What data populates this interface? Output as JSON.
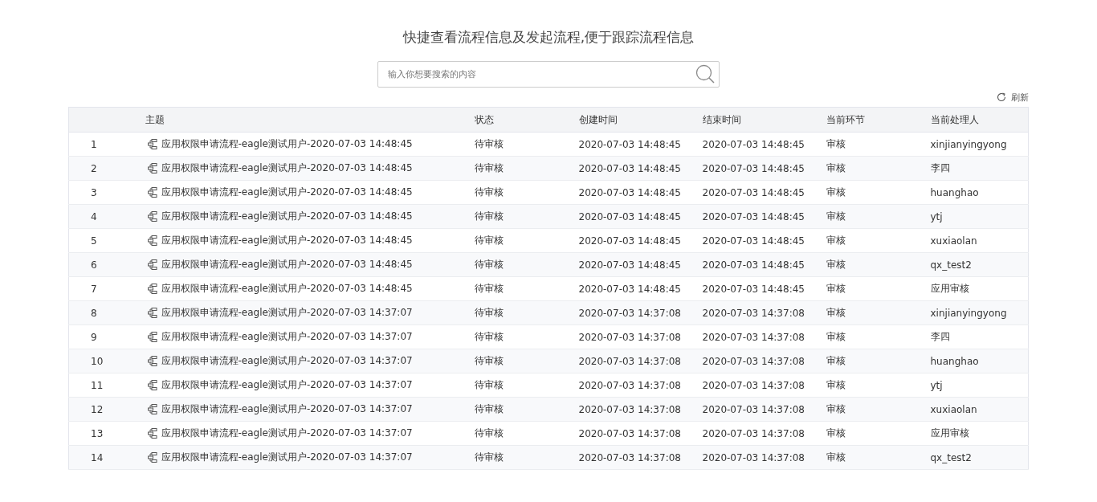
{
  "title": "快捷查看流程信息及发起流程,便于跟踪流程信息",
  "search": {
    "placeholder": "输入你想要搜索的内容"
  },
  "refresh": "刷新",
  "table": {
    "columns": [
      "",
      "主题",
      "状态",
      "创建时间",
      "结束时间",
      "当前环节",
      "当前处理人"
    ],
    "rows": [
      [
        "1",
        "应用权限申请流程-eagle测试用户-2020-07-03 14:48:45",
        "待审核",
        "2020-07-03 14:48:45",
        "2020-07-03 14:48:45",
        "审核",
        "xinjianyingyong"
      ],
      [
        "2",
        "应用权限申请流程-eagle测试用户-2020-07-03 14:48:45",
        "待审核",
        "2020-07-03 14:48:45",
        "2020-07-03 14:48:45",
        "审核",
        "李四"
      ],
      [
        "3",
        "应用权限申请流程-eagle测试用户-2020-07-03 14:48:45",
        "待审核",
        "2020-07-03 14:48:45",
        "2020-07-03 14:48:45",
        "审核",
        "huanghao"
      ],
      [
        "4",
        "应用权限申请流程-eagle测试用户-2020-07-03 14:48:45",
        "待审核",
        "2020-07-03 14:48:45",
        "2020-07-03 14:48:45",
        "审核",
        "ytj"
      ],
      [
        "5",
        "应用权限申请流程-eagle测试用户-2020-07-03 14:48:45",
        "待审核",
        "2020-07-03 14:48:45",
        "2020-07-03 14:48:45",
        "审核",
        "xuxiaolan"
      ],
      [
        "6",
        "应用权限申请流程-eagle测试用户-2020-07-03 14:48:45",
        "待审核",
        "2020-07-03 14:48:45",
        "2020-07-03 14:48:45",
        "审核",
        "qx_test2"
      ],
      [
        "7",
        "应用权限申请流程-eagle测试用户-2020-07-03 14:48:45",
        "待审核",
        "2020-07-03 14:48:45",
        "2020-07-03 14:48:45",
        "审核",
        "应用审核"
      ],
      [
        "8",
        "应用权限申请流程-eagle测试用户-2020-07-03 14:37:07",
        "待审核",
        "2020-07-03 14:37:08",
        "2020-07-03 14:37:08",
        "审核",
        "xinjianyingyong"
      ],
      [
        "9",
        "应用权限申请流程-eagle测试用户-2020-07-03 14:37:07",
        "待审核",
        "2020-07-03 14:37:08",
        "2020-07-03 14:37:08",
        "审核",
        "李四"
      ],
      [
        "10",
        "应用权限申请流程-eagle测试用户-2020-07-03 14:37:07",
        "待审核",
        "2020-07-03 14:37:08",
        "2020-07-03 14:37:08",
        "审核",
        "huanghao"
      ],
      [
        "11",
        "应用权限申请流程-eagle测试用户-2020-07-03 14:37:07",
        "待审核",
        "2020-07-03 14:37:08",
        "2020-07-03 14:37:08",
        "审核",
        "ytj"
      ],
      [
        "12",
        "应用权限申请流程-eagle测试用户-2020-07-03 14:37:07",
        "待审核",
        "2020-07-03 14:37:08",
        "2020-07-03 14:37:08",
        "审核",
        "xuxiaolan"
      ],
      [
        "13",
        "应用权限申请流程-eagle测试用户-2020-07-03 14:37:07",
        "待审核",
        "2020-07-03 14:37:08",
        "2020-07-03 14:37:08",
        "审核",
        "应用审核"
      ],
      [
        "14",
        "应用权限申请流程-eagle测试用户-2020-07-03 14:37:07",
        "待审核",
        "2020-07-03 14:37:08",
        "2020-07-03 14:37:08",
        "审核",
        "qx_test2"
      ]
    ]
  }
}
